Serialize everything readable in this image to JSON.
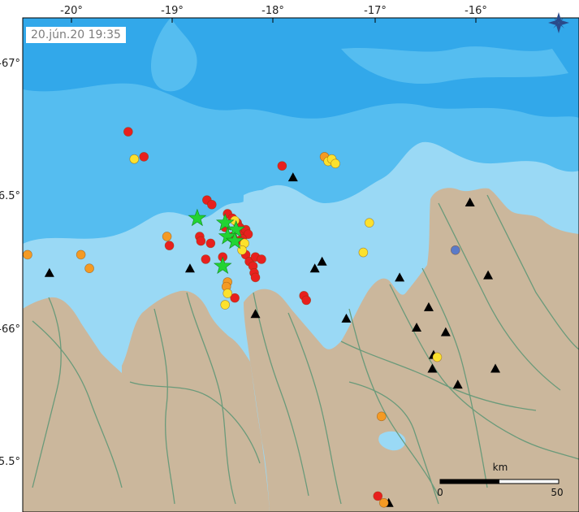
{
  "timestamp": "20.jún.20  19:35",
  "compass_icon": "north-arrow-icon",
  "colors": {
    "land": "#cbb79c",
    "deep_sea": "#32a8ea",
    "mid_sea": "#55bdf0",
    "shallow_sea": "#9ad9f5",
    "roads": "#6a9a7a",
    "recent": "#e8201e",
    "hours": "#f49a24",
    "day": "#fce12d",
    "older": "#5a7ac8",
    "large": "#22d433",
    "station": "#000000"
  },
  "axes": {
    "lon_labels": [
      "-20°",
      "-19°",
      "-18°",
      "-17°",
      "-16°"
    ],
    "lat_labels": [
      "-67°",
      "-66.5°",
      "-66°",
      "-65.5°"
    ]
  },
  "scale_bar": {
    "unit": "km",
    "start": "0",
    "end": "50"
  },
  "earthquakes": [
    {
      "lon": -19.52,
      "lat": 66.73,
      "cat": "recent"
    },
    {
      "lon": -19.39,
      "lat": 66.62,
      "cat": "recent"
    },
    {
      "lon": -19.47,
      "lat": 66.61,
      "cat": "day"
    },
    {
      "lon": -18.25,
      "lat": 66.58,
      "cat": "recent"
    },
    {
      "lon": -17.9,
      "lat": 66.62,
      "cat": "hours"
    },
    {
      "lon": -17.87,
      "lat": 66.6,
      "cat": "day"
    },
    {
      "lon": -17.84,
      "lat": 66.61,
      "cat": "day"
    },
    {
      "lon": -17.81,
      "lat": 66.59,
      "cat": "day"
    },
    {
      "lon": -17.53,
      "lat": 66.33,
      "cat": "day"
    },
    {
      "lon": -17.58,
      "lat": 66.2,
      "cat": "day"
    },
    {
      "lon": -16.82,
      "lat": 66.21,
      "cat": "older"
    },
    {
      "lon": -18.87,
      "lat": 66.43,
      "cat": "recent"
    },
    {
      "lon": -18.83,
      "lat": 66.41,
      "cat": "recent"
    },
    {
      "lon": -18.7,
      "lat": 66.37,
      "cat": "recent"
    },
    {
      "lon": -18.66,
      "lat": 66.35,
      "cat": "recent"
    },
    {
      "lon": -18.62,
      "lat": 66.33,
      "cat": "recent"
    },
    {
      "lon": -18.6,
      "lat": 66.31,
      "cat": "recent"
    },
    {
      "lon": -18.57,
      "lat": 66.29,
      "cat": "recent"
    },
    {
      "lon": -18.55,
      "lat": 66.3,
      "cat": "recent"
    },
    {
      "lon": -18.53,
      "lat": 66.28,
      "cat": "recent"
    },
    {
      "lon": -18.58,
      "lat": 66.26,
      "cat": "recent"
    },
    {
      "lon": -18.62,
      "lat": 66.25,
      "cat": "recent"
    },
    {
      "lon": -18.66,
      "lat": 66.27,
      "cat": "recent"
    },
    {
      "lon": -18.72,
      "lat": 66.31,
      "cat": "recent"
    },
    {
      "lon": -18.93,
      "lat": 66.27,
      "cat": "recent"
    },
    {
      "lon": -18.92,
      "lat": 66.25,
      "cat": "recent"
    },
    {
      "lon": -18.84,
      "lat": 66.24,
      "cat": "recent"
    },
    {
      "lon": -19.18,
      "lat": 66.23,
      "cat": "recent"
    },
    {
      "lon": -18.88,
      "lat": 66.17,
      "cat": "recent"
    },
    {
      "lon": -18.74,
      "lat": 66.18,
      "cat": "recent"
    },
    {
      "lon": -18.55,
      "lat": 66.19,
      "cat": "recent"
    },
    {
      "lon": -18.52,
      "lat": 66.16,
      "cat": "recent"
    },
    {
      "lon": -18.47,
      "lat": 66.18,
      "cat": "recent"
    },
    {
      "lon": -18.42,
      "lat": 66.17,
      "cat": "recent"
    },
    {
      "lon": -18.49,
      "lat": 66.14,
      "cat": "recent"
    },
    {
      "lon": -18.48,
      "lat": 66.11,
      "cat": "recent"
    },
    {
      "lon": -18.47,
      "lat": 66.09,
      "cat": "recent"
    },
    {
      "lon": -18.64,
      "lat": 66.0,
      "cat": "recent"
    },
    {
      "lon": -18.07,
      "lat": 66.01,
      "cat": "recent"
    },
    {
      "lon": -18.05,
      "lat": 65.99,
      "cat": "recent"
    },
    {
      "lon": -17.46,
      "lat": 65.13,
      "cat": "recent"
    },
    {
      "lon": -19.2,
      "lat": 66.27,
      "cat": "hours"
    },
    {
      "lon": -20.35,
      "lat": 66.19,
      "cat": "hours"
    },
    {
      "lon": -19.91,
      "lat": 66.19,
      "cat": "hours"
    },
    {
      "lon": -19.84,
      "lat": 66.13,
      "cat": "hours"
    },
    {
      "lon": -18.7,
      "lat": 66.07,
      "cat": "hours"
    },
    {
      "lon": -18.71,
      "lat": 66.05,
      "cat": "hours"
    },
    {
      "lon": -17.43,
      "lat": 65.48,
      "cat": "hours"
    },
    {
      "lon": -17.41,
      "lat": 65.1,
      "cat": "hours"
    },
    {
      "lon": -18.7,
      "lat": 66.02,
      "cat": "day"
    },
    {
      "lon": -18.72,
      "lat": 65.97,
      "cat": "day"
    },
    {
      "lon": -18.64,
      "lat": 66.34,
      "cat": "day"
    },
    {
      "lon": -18.56,
      "lat": 66.24,
      "cat": "day"
    },
    {
      "lon": -18.58,
      "lat": 66.21,
      "cat": "day"
    },
    {
      "lon": -16.97,
      "lat": 65.74,
      "cat": "day"
    }
  ],
  "large_events": [
    {
      "lon": -18.95,
      "lat": 66.35
    },
    {
      "lon": -18.72,
      "lat": 66.33
    },
    {
      "lon": -18.63,
      "lat": 66.3
    },
    {
      "lon": -18.7,
      "lat": 66.27
    },
    {
      "lon": -18.64,
      "lat": 66.25
    },
    {
      "lon": -18.74,
      "lat": 66.14
    }
  ],
  "stations": [
    {
      "lon": -20.17,
      "lat": 66.11
    },
    {
      "lon": -19.01,
      "lat": 66.13
    },
    {
      "lon": -18.16,
      "lat": 66.53
    },
    {
      "lon": -17.92,
      "lat": 66.16
    },
    {
      "lon": -17.98,
      "lat": 66.13
    },
    {
      "lon": -18.47,
      "lat": 65.93
    },
    {
      "lon": -17.72,
      "lat": 65.91
    },
    {
      "lon": -17.28,
      "lat": 66.09
    },
    {
      "lon": -16.7,
      "lat": 66.42
    },
    {
      "lon": -16.55,
      "lat": 66.1
    },
    {
      "lon": -17.04,
      "lat": 65.96
    },
    {
      "lon": -17.14,
      "lat": 65.87
    },
    {
      "lon": -16.9,
      "lat": 65.85
    },
    {
      "lon": -17.0,
      "lat": 65.75
    },
    {
      "lon": -17.01,
      "lat": 65.69
    },
    {
      "lon": -16.8,
      "lat": 65.62
    },
    {
      "lon": -16.49,
      "lat": 65.69
    },
    {
      "lon": -17.37,
      "lat": 65.1
    }
  ],
  "map_extent": {
    "lon_min": -20.39,
    "lon_max": -15.8,
    "lat_min": 65.06,
    "lat_max": 67.23
  }
}
